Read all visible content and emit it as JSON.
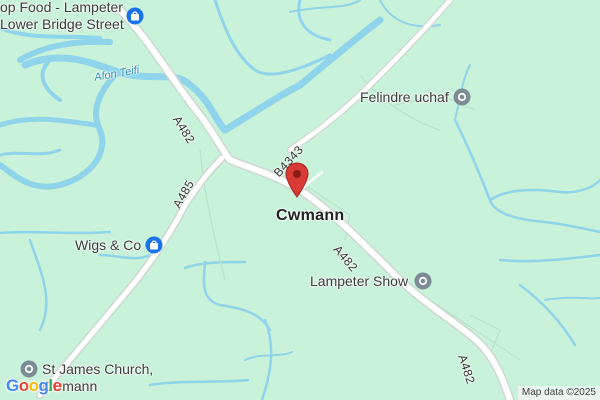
{
  "map": {
    "center_place": "Cwmann",
    "roads": [
      {
        "id": "a482-north",
        "label": "A482"
      },
      {
        "id": "a482-south",
        "label": "A482"
      },
      {
        "id": "a482-east",
        "label": "A482"
      },
      {
        "id": "a485",
        "label": "A485"
      },
      {
        "id": "b4343",
        "label": "B4343"
      }
    ],
    "river": {
      "label": "Afon Teifi"
    },
    "pois": [
      {
        "id": "coop",
        "line1": "op Food - Lampeter",
        "line2": "Lower Bridge Street",
        "icon": "shopping-bag-icon"
      },
      {
        "id": "felindre",
        "label": "Felindre uchaf",
        "icon": "place-dot-icon"
      },
      {
        "id": "wigs",
        "label": "Wigs & Co",
        "icon": "shopping-bag-icon"
      },
      {
        "id": "show",
        "label": "Lampeter Show",
        "icon": "place-dot-icon"
      },
      {
        "id": "church",
        "line1": "St James Church,",
        "line2": "Cwmann",
        "icon": "place-dot-icon"
      }
    ],
    "marker": {
      "icon": "location-pin-icon",
      "color": "#d93a35"
    },
    "attribution": "Map data ©2025",
    "logo": "Google",
    "colors": {
      "land": "#c9f2da",
      "water": "#8fd4ea",
      "road": "#ffffff",
      "road_casing": "#cfd7d2",
      "poi_shop": "#1a73e8",
      "poi_place": "#7c8b96",
      "marker": "#d93a35"
    }
  }
}
